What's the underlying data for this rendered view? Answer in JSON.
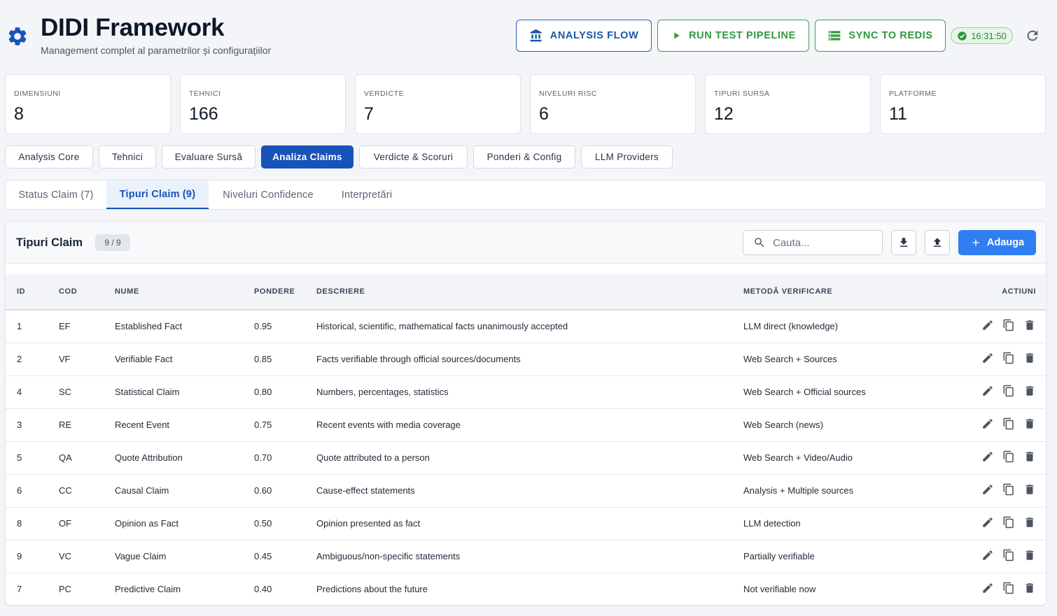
{
  "header": {
    "title": "DIDI Framework",
    "subtitle": "Management complet al parametrilor și configurațiilor",
    "buttons": {
      "analysis_flow": "ANALYSIS FLOW",
      "run_test": "RUN TEST PIPELINE",
      "sync_redis": "SYNC TO REDIS"
    },
    "time": "16:31:50"
  },
  "stats": [
    {
      "label": "DIMENSIUNI",
      "value": "8"
    },
    {
      "label": "TEHNICI",
      "value": "166"
    },
    {
      "label": "VERDICTE",
      "value": "7"
    },
    {
      "label": "NIVELURI RISC",
      "value": "6"
    },
    {
      "label": "TIPURI SURSA",
      "value": "12"
    },
    {
      "label": "PLATFORME",
      "value": "11"
    }
  ],
  "module_tabs": [
    {
      "label": "Analysis Core"
    },
    {
      "label": "Tehnici"
    },
    {
      "label": "Evaluare Sursă"
    },
    {
      "label": "Analiza Claims"
    },
    {
      "label": "Verdicte & Scoruri"
    },
    {
      "label": "Ponderi & Config"
    },
    {
      "label": "LLM Providers"
    }
  ],
  "sub_tabs": [
    {
      "label": "Status Claim (7)"
    },
    {
      "label": "Tipuri Claim (9)"
    },
    {
      "label": "Niveluri Confidence"
    },
    {
      "label": "Interpretări"
    }
  ],
  "panel": {
    "title": "Tipuri Claim",
    "count": "9 / 9",
    "search_placeholder": "Cauta...",
    "add_label": "Adauga"
  },
  "table": {
    "headers": {
      "id": "ID",
      "cod": "COD",
      "nume": "NUME",
      "pondere": "PONDERE",
      "descriere": "DESCRIERE",
      "metoda": "METODĂ VERIFICARE",
      "actiuni": "ACTIUNI"
    },
    "rows": [
      {
        "id": "1",
        "cod": "EF",
        "nume": "Established Fact",
        "pondere": "0.95",
        "descriere": "Historical, scientific, mathematical facts unanimously accepted",
        "metoda": "LLM direct (knowledge)"
      },
      {
        "id": "2",
        "cod": "VF",
        "nume": "Verifiable Fact",
        "pondere": "0.85",
        "descriere": "Facts verifiable through official sources/documents",
        "metoda": "Web Search + Sources"
      },
      {
        "id": "4",
        "cod": "SC",
        "nume": "Statistical Claim",
        "pondere": "0.80",
        "descriere": "Numbers, percentages, statistics",
        "metoda": "Web Search + Official sources"
      },
      {
        "id": "3",
        "cod": "RE",
        "nume": "Recent Event",
        "pondere": "0.75",
        "descriere": "Recent events with media coverage",
        "metoda": "Web Search (news)"
      },
      {
        "id": "5",
        "cod": "QA",
        "nume": "Quote Attribution",
        "pondere": "0.70",
        "descriere": "Quote attributed to a person",
        "metoda": "Web Search + Video/Audio"
      },
      {
        "id": "6",
        "cod": "CC",
        "nume": "Causal Claim",
        "pondere": "0.60",
        "descriere": "Cause-effect statements",
        "metoda": "Analysis + Multiple sources"
      },
      {
        "id": "8",
        "cod": "OF",
        "nume": "Opinion as Fact",
        "pondere": "0.50",
        "descriere": "Opinion presented as fact",
        "metoda": "LLM detection"
      },
      {
        "id": "9",
        "cod": "VC",
        "nume": "Vague Claim",
        "pondere": "0.45",
        "descriere": "Ambiguous/non-specific statements",
        "metoda": "Partially verifiable"
      },
      {
        "id": "7",
        "cod": "PC",
        "nume": "Predictive Claim",
        "pondere": "0.40",
        "descriere": "Predictions about the future",
        "metoda": "Not verifiable now"
      }
    ]
  },
  "colors": {
    "primary": "#1753b8",
    "success": "#2f9a3d",
    "add_button": "#2f7ff2"
  }
}
